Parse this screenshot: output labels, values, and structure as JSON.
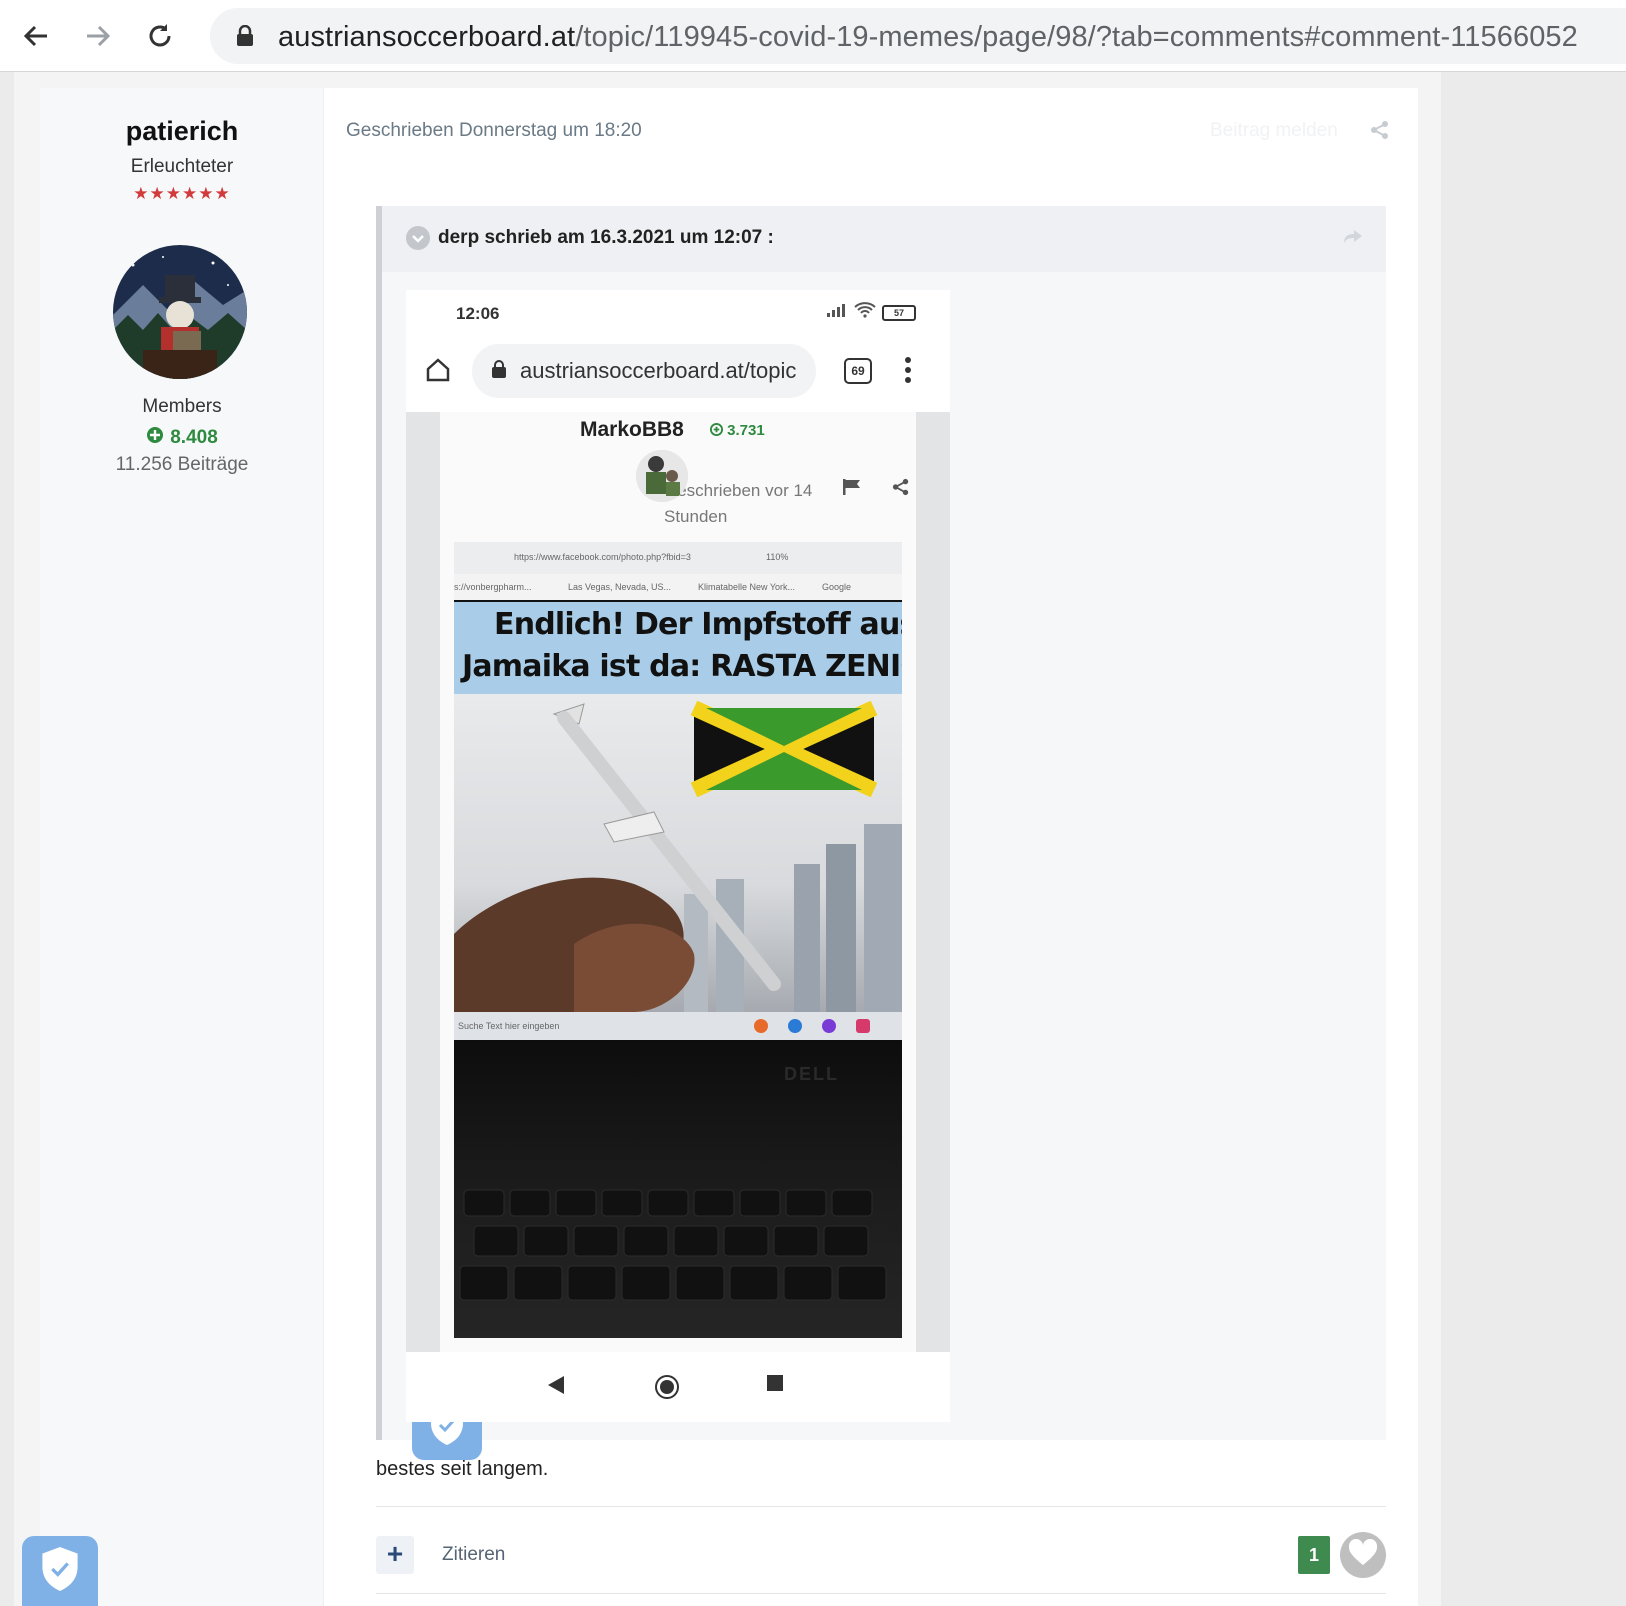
{
  "browser": {
    "url_host": "austriansoccerboard.at",
    "url_path": "/topic/119945-covid-19-memes/page/98/?tab=comments#comment-11566052",
    "icons": [
      "back-icon",
      "forward-icon",
      "reload-icon",
      "lock-icon"
    ]
  },
  "author": {
    "name": "patierich",
    "title": "Erleuchteter",
    "stars": "★★★★★★",
    "group": "Members",
    "reputation": "8.408",
    "posts": "11.256 Beiträge"
  },
  "post": {
    "meta": "Geschrieben Donnerstag um 18:20",
    "report_label": "Beitrag melden",
    "quote": {
      "citation": "derp schrieb am 16.3.2021 um 12:07 :",
      "screenshot": {
        "time": "12:06",
        "battery": "57",
        "url": "austriansoccerboard.at/topic",
        "tab_count": "69",
        "username": "MarkoBB8",
        "reputation": "3.731",
        "written_ago": "Geschrieben vor 14 Stunden",
        "meme": {
          "browser_url": "https://www.facebook.com/photo.php?fbid=3",
          "zoom": "110%",
          "bookmarks": [
            "s://vonbergpharm...",
            "Las Vegas, Nevada, US...",
            "Klimatabelle New York...",
            "Google"
          ],
          "caption_line1": "Endlich! Der Impfstoff aus",
          "caption_line2": "Jamaika ist da: RASTA ZENICA!",
          "taskbar_search": "Suche Text hier eingeben",
          "laptop_brand": "DELL",
          "flag_colors": {
            "green": "#3a9a2c",
            "yellow": "#f2d21b",
            "black": "#111111"
          }
        }
      }
    },
    "text": "bestes seit langem.",
    "actions": {
      "plus": "+",
      "quote_label": "Zitieren",
      "like_count": "1"
    }
  },
  "colors": {
    "reputation_green": "#2e8a3f",
    "like_badge": "#3e8a4f",
    "shield_blue": "#7fb1e6"
  }
}
